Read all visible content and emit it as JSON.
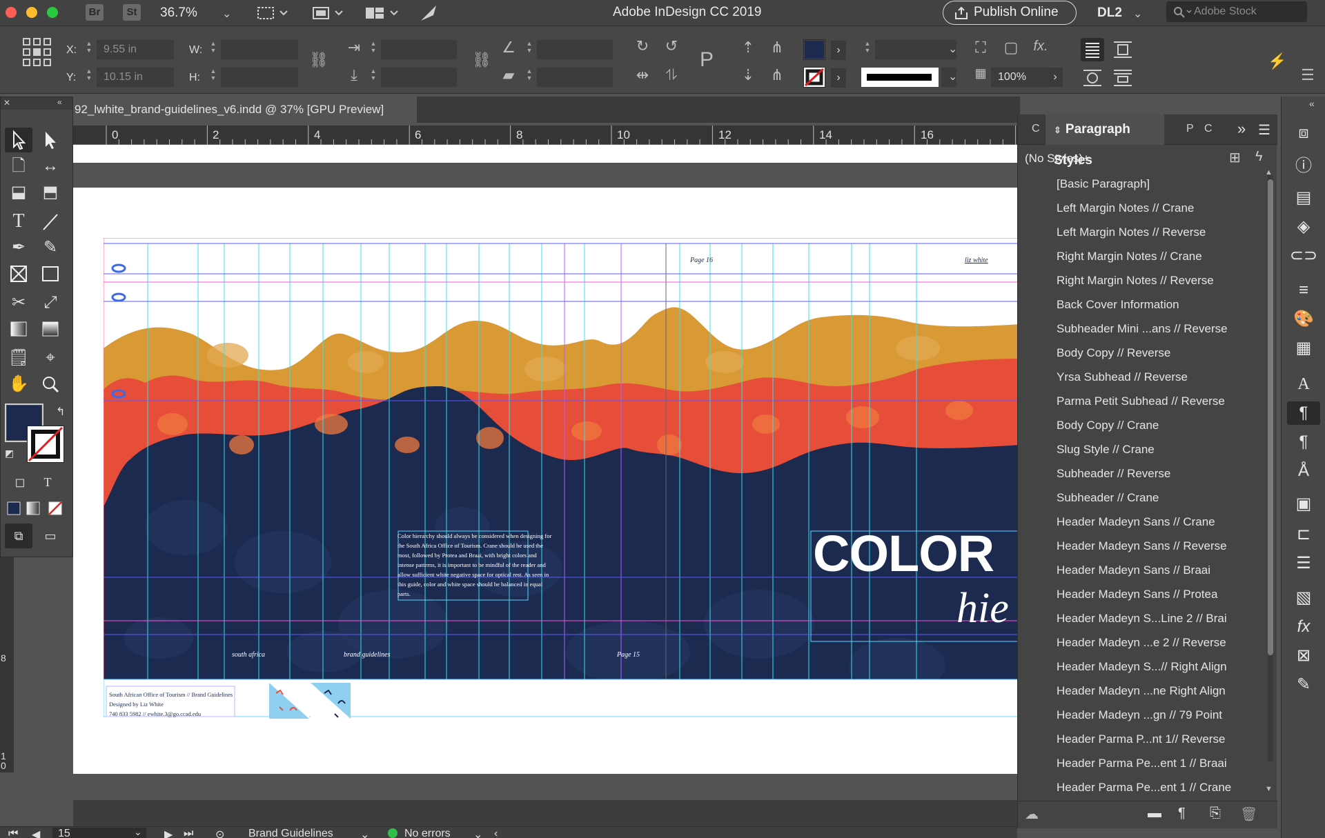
{
  "app": {
    "title": "Adobe InDesign CC 2019",
    "bridge_label": "Br",
    "stock_label": "St",
    "zoom": "36.7%",
    "publish_label": "Publish Online",
    "workspace": "DL2",
    "search_placeholder": "Adobe Stock"
  },
  "control": {
    "x_label": "X:",
    "x_value": "9.55 in",
    "y_label": "Y:",
    "y_value": "10.15 in",
    "w_label": "W:",
    "h_label": "H:",
    "opacity": "100%",
    "fill_color": "#1b2a4e",
    "fx_label": "fx."
  },
  "document": {
    "tab_title": "92_lwhite_brand-guidelines_v6.indd @ 37% [GPU Preview]",
    "ruler_labels": [
      "0",
      "2",
      "4",
      "6",
      "8",
      "10",
      "12",
      "14",
      "16"
    ],
    "vruler_labels": [
      "8",
      "1",
      "0"
    ],
    "page_left": "Page 16",
    "author_mark": "liz white",
    "footer_left": "south africa",
    "footer_mid": "brand guidelines",
    "footer_page": "Page 15",
    "body_text": "Color hierarchy should always be considered when designing for the South Africa Office of Tourism. Crane should be used the most, followed by Protea and Braai, with bright colors and intense patterns, it is important to be mindful of the reader and allow sufficient white negative space for optical rest. As seen in this guide, color and white space should be balanced in equal parts.",
    "headline": "COLOR",
    "subheadline": "hie",
    "slug_line1": "South African Office of Tourism // Brand Guidelines",
    "slug_line2": "Designed by Liz White",
    "slug_line3": "740 833 5982 // ewhite.3@go.ccad.edu",
    "colors": {
      "navy": "#1b2a4e",
      "red": "#e64e3a",
      "gold": "#d99a36"
    }
  },
  "paragraph_styles": {
    "tab_label": "Paragraph Styles",
    "current": "(No Styles)+",
    "items": [
      "[Basic Paragraph]",
      "Left Margin Notes // Crane",
      "Left Margin Notes // Reverse",
      "Right Margin Notes // Crane",
      "Right Margin Notes // Reverse",
      "Back Cover Information",
      "Subheader Mini ...ans // Reverse",
      "Body Copy // Reverse",
      "Yrsa Subhead // Reverse",
      "Parma Petit Subhead // Reverse",
      "Body Copy // Crane",
      "Slug Style // Crane",
      "Subheader // Reverse",
      "Subheader // Crane",
      "Header Madeyn Sans // Crane",
      "Header Madeyn Sans // Reverse",
      "Header Madeyn Sans // Braai",
      "Header Madeyn Sans // Protea",
      "Header Madeyn S...Line 2 // Brai",
      "Header Madeyn ...e 2 // Reverse",
      "Header Madeyn S...// Right Align",
      "Header Madeyn ...ne Right Align",
      "Header Madeyn ...gn // 79 Point",
      "Header Parma P...nt 1// Reverse",
      "Header Parma Pe...ent 1 // Braai",
      "Header Parma Pe...ent 1 // Crane"
    ]
  },
  "status": {
    "page_number": "15",
    "page_name": "Brand Guidelines",
    "preflight": "No errors",
    "preflight_color": "#2fbf4a"
  }
}
